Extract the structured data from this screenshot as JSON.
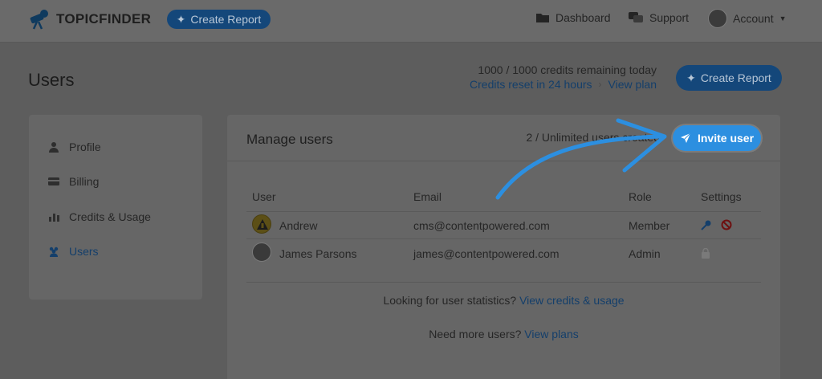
{
  "nav": {
    "brand": "TOPICFINDER",
    "create_report": "Create Report",
    "dashboard": "Dashboard",
    "support": "Support",
    "account": "Account"
  },
  "header": {
    "title": "Users",
    "credits": "1000 / 1000 credits remaining today",
    "credits_reset": "Credits reset in 24 hours",
    "view_plan": "View plan",
    "create_report": "Create Report"
  },
  "sidebar": {
    "items": [
      {
        "label": "Profile",
        "icon": "user-icon"
      },
      {
        "label": "Billing",
        "icon": "card-icon"
      },
      {
        "label": "Credits & Usage",
        "icon": "bar-chart-icon"
      },
      {
        "label": "Users",
        "icon": "users-icon"
      }
    ]
  },
  "panel": {
    "title": "Manage users",
    "users_count": "2 / Unlimited users created",
    "invite": "Invite user",
    "columns": [
      "User",
      "Email",
      "Role",
      "Settings"
    ],
    "rows": [
      {
        "name": "Andrew",
        "email": "cms@contentpowered.com",
        "role": "Member"
      },
      {
        "name": "James Parsons",
        "email": "james@contentpowered.com",
        "role": "Admin"
      }
    ],
    "stats_text": "Looking for user statistics?",
    "stats_link": "View credits & usage",
    "more_text": "Need more users?",
    "more_link": "View plans"
  },
  "colors": {
    "accent": "#2c8fe0",
    "dark_blue": "#14477a",
    "overlay": "#5d5d5d"
  }
}
